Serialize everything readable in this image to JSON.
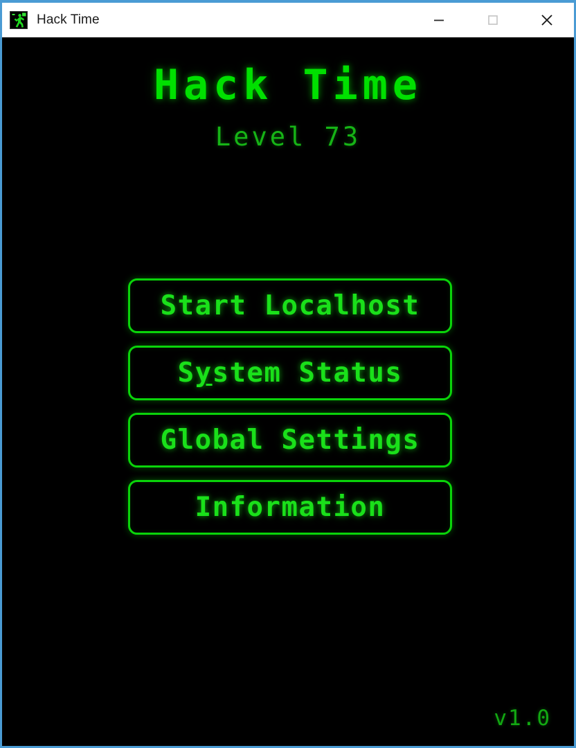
{
  "window": {
    "title": "Hack Time",
    "icon": "running-man-icon",
    "frame_color": "#4a9bd4",
    "titlebar_background": "#ffffff",
    "client_background": "#000000",
    "controls": {
      "minimize": "minimize-icon",
      "maximize": "maximize-icon",
      "close": "close-icon"
    }
  },
  "screen": {
    "title": "Hack Time",
    "level_label": "Level 73",
    "version": "v1.0",
    "accent_color": "#0ad40a",
    "title_color": "#00e000",
    "level_color": "#16b416",
    "version_color": "#12a812"
  },
  "menu": {
    "buttons": [
      {
        "label": "Start Localhost",
        "name": "start-localhost-button",
        "mnemonic": ""
      },
      {
        "label": "System Status",
        "name": "system-status-button",
        "mnemonic": "y"
      },
      {
        "label": "Global Settings",
        "name": "global-settings-button",
        "mnemonic": ""
      },
      {
        "label": "Information",
        "name": "information-button",
        "mnemonic": ""
      }
    ]
  }
}
